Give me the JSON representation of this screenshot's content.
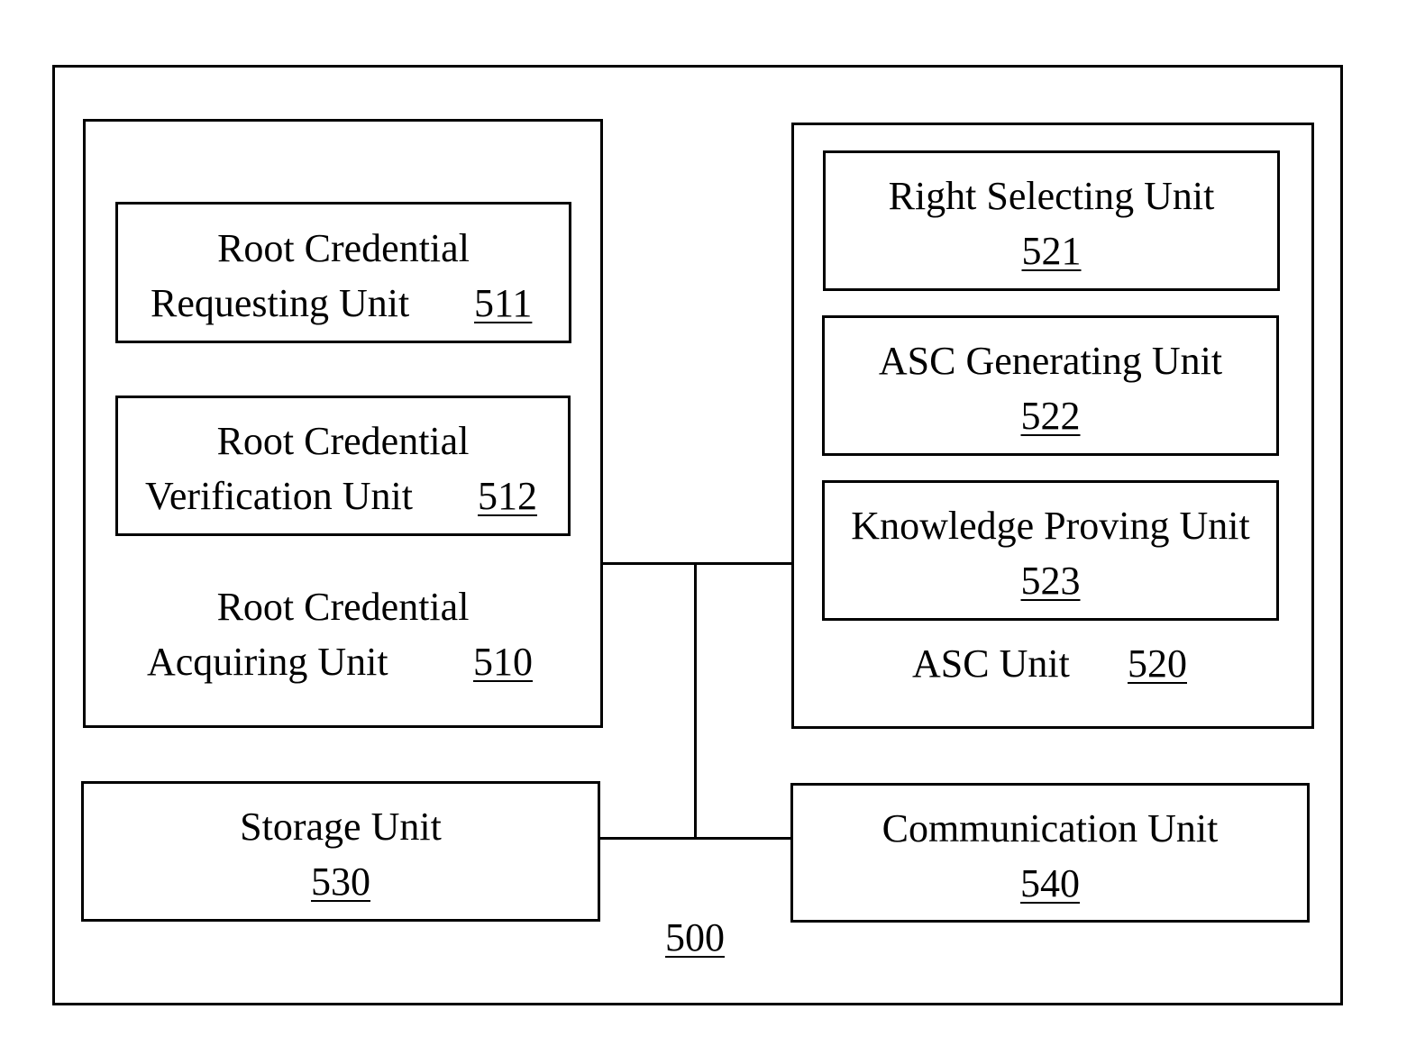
{
  "diagram": {
    "outer": {
      "ref": "500"
    },
    "root_credential_acquiring_unit": {
      "line1": "Root Credential",
      "line2": "Acquiring Unit",
      "ref": "510",
      "children": [
        {
          "line1": "Root Credential",
          "line2": "Requesting Unit",
          "ref": "511"
        },
        {
          "line1": "Root Credential",
          "line2": "Verification Unit",
          "ref": "512"
        }
      ]
    },
    "asc_unit": {
      "label": "ASC Unit",
      "ref": "520",
      "children": [
        {
          "label": "Right Selecting Unit",
          "ref": "521"
        },
        {
          "label": "ASC Generating Unit",
          "ref": "522"
        },
        {
          "label": "Knowledge Proving Unit",
          "ref": "523"
        }
      ]
    },
    "storage_unit": {
      "label": "Storage Unit",
      "ref": "530"
    },
    "communication_unit": {
      "label": "Communication Unit",
      "ref": "540"
    }
  }
}
